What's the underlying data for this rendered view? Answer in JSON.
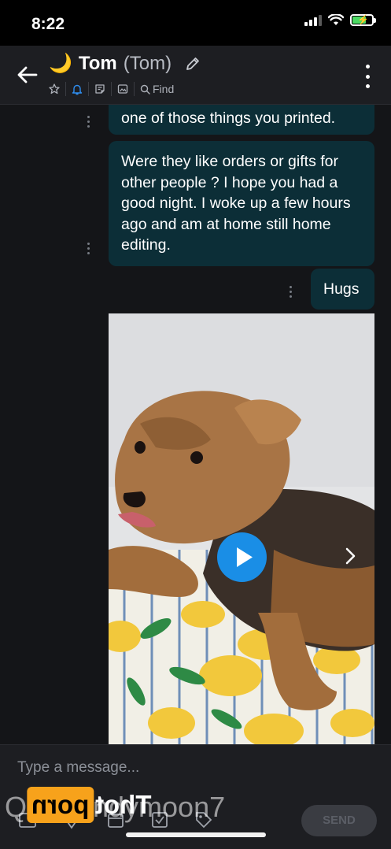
{
  "status": {
    "time": "8:22"
  },
  "header": {
    "emoji": "🌙",
    "name": "Tom",
    "alias": "(Tom)",
    "find_label": "Find"
  },
  "messages": [
    {
      "text": "one of those things you printed."
    },
    {
      "text": "Were they like orders or gifts for other people ? I hope you had a good night. I woke up a few hours ago and am at home still home editing."
    },
    {
      "text": "Hugs"
    }
  ],
  "composer": {
    "placeholder": "Type a message...",
    "send_label": "SEND"
  },
  "watermark": {
    "text": "Q      m Cindymoon7",
    "logo_box": "porn",
    "logo_rest": "Thot"
  },
  "colors": {
    "bubble": "#0c2e37",
    "play": "#1a8ee6",
    "accent_bell": "#2f8ef0"
  },
  "icons": [
    "back-arrow-icon",
    "moon-icon",
    "pencil-icon",
    "star-icon",
    "bell-icon",
    "note-icon",
    "image-icon",
    "search-icon",
    "more-vert-icon",
    "play-icon",
    "chevron-right-icon",
    "attach-icon",
    "location-icon",
    "calendar-icon",
    "task-icon",
    "tag-icon"
  ]
}
